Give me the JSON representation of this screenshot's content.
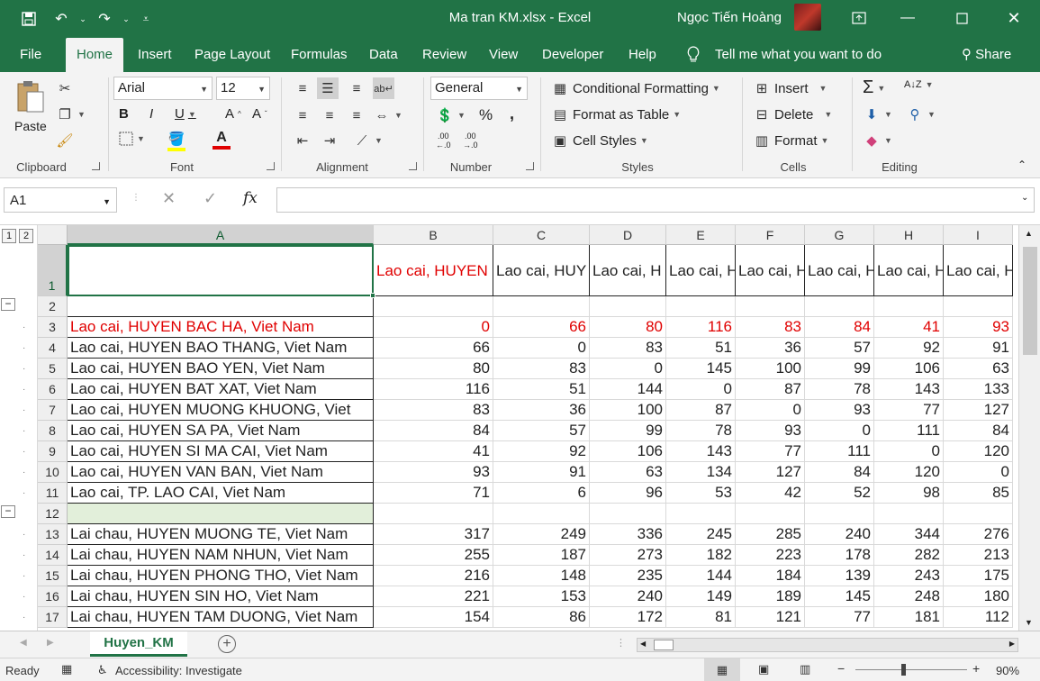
{
  "title_bar": {
    "file_title": "Ma tran KM.xlsx  -  Excel",
    "user_name": "Ngọc Tiến Hoàng"
  },
  "tabs": [
    "File",
    "Home",
    "Insert",
    "Page Layout",
    "Formulas",
    "Data",
    "Review",
    "View",
    "Developer",
    "Help"
  ],
  "active_tab": "Home",
  "tell_me": "Tell me what you want to do",
  "share": "Share",
  "ribbon": {
    "clipboard": {
      "paste": "Paste",
      "label": "Clipboard"
    },
    "font": {
      "name": "Arial",
      "size": "12",
      "label": "Font",
      "bold": "B",
      "italic": "I",
      "underline": "U",
      "font_color": "#e00000",
      "fill_color": "#ffff00"
    },
    "alignment": {
      "label": "Alignment"
    },
    "number": {
      "format": "General",
      "label": "Number",
      "percent": "%",
      "comma": ",",
      "inc_dec": ".00",
      "inc_dec2": "←.0",
      "dec_inc": ".00",
      "dec_inc2": "→.0"
    },
    "styles": {
      "conditional": "Conditional Formatting",
      "format_table": "Format as Table",
      "cell_styles": "Cell Styles",
      "label": "Styles"
    },
    "cells": {
      "insert": "Insert",
      "delete": "Delete",
      "format": "Format",
      "label": "Cells"
    },
    "editing": {
      "label": "Editing",
      "sigma": "Σ",
      "sort": "A↓Z"
    }
  },
  "formula_bar": {
    "name_box": "A1",
    "formula": "",
    "fx": "fx",
    "cancel": "✕",
    "enter": "✓"
  },
  "grid": {
    "columns": [
      "A",
      "B",
      "C",
      "D",
      "E",
      "F",
      "G",
      "H",
      "I"
    ],
    "header_row_values": [
      "",
      "Lao cai, HUYEN",
      "Lao cai, HUY",
      "Lao cai, H",
      "Lao cai, H",
      "Lao cai, H",
      "Lao cai, H",
      "Lao cai, H",
      "Lao cai, H"
    ],
    "rows": [
      {
        "num": "1",
        "label": "",
        "values": []
      },
      {
        "num": "2",
        "label": "",
        "values": []
      },
      {
        "num": "3",
        "label": "Lao cai, HUYEN BAC HA, Viet Nam",
        "values": [
          "0",
          "66",
          "80",
          "116",
          "83",
          "84",
          "41",
          "93"
        ],
        "red": true
      },
      {
        "num": "4",
        "label": "Lao cai, HUYEN BAO THANG, Viet Nam",
        "values": [
          "66",
          "0",
          "83",
          "51",
          "36",
          "57",
          "92",
          "91"
        ]
      },
      {
        "num": "5",
        "label": "Lao cai, HUYEN BAO YEN, Viet Nam",
        "values": [
          "80",
          "83",
          "0",
          "145",
          "100",
          "99",
          "106",
          "63"
        ]
      },
      {
        "num": "6",
        "label": "Lao cai, HUYEN BAT XAT, Viet Nam",
        "values": [
          "116",
          "51",
          "144",
          "0",
          "87",
          "78",
          "143",
          "133"
        ]
      },
      {
        "num": "7",
        "label": "Lao cai, HUYEN MUONG KHUONG, Viet",
        "values": [
          "83",
          "36",
          "100",
          "87",
          "0",
          "93",
          "77",
          "127"
        ]
      },
      {
        "num": "8",
        "label": "Lao cai, HUYEN SA PA, Viet Nam",
        "values": [
          "84",
          "57",
          "99",
          "78",
          "93",
          "0",
          "111",
          "84"
        ]
      },
      {
        "num": "9",
        "label": "Lao cai, HUYEN SI MA CAI, Viet Nam",
        "values": [
          "41",
          "92",
          "106",
          "143",
          "77",
          "111",
          "0",
          "120"
        ]
      },
      {
        "num": "10",
        "label": "Lao cai, HUYEN VAN BAN, Viet Nam",
        "values": [
          "93",
          "91",
          "63",
          "134",
          "127",
          "84",
          "120",
          "0"
        ]
      },
      {
        "num": "11",
        "label": "Lao cai, TP. LAO CAI, Viet Nam",
        "values": [
          "71",
          "6",
          "96",
          "53",
          "42",
          "52",
          "98",
          "85"
        ]
      },
      {
        "num": "12",
        "label": "",
        "values": [],
        "green": true
      },
      {
        "num": "13",
        "label": "Lai chau, HUYEN MUONG TE, Viet Nam",
        "values": [
          "317",
          "249",
          "336",
          "245",
          "285",
          "240",
          "344",
          "276"
        ]
      },
      {
        "num": "14",
        "label": "Lai chau, HUYEN NAM NHUN, Viet Nam",
        "values": [
          "255",
          "187",
          "273",
          "182",
          "223",
          "178",
          "282",
          "213"
        ]
      },
      {
        "num": "15",
        "label": "Lai chau, HUYEN PHONG THO, Viet Nam",
        "values": [
          "216",
          "148",
          "235",
          "144",
          "184",
          "139",
          "243",
          "175"
        ]
      },
      {
        "num": "16",
        "label": "Lai chau, HUYEN SIN HO, Viet Nam",
        "values": [
          "221",
          "153",
          "240",
          "149",
          "189",
          "145",
          "248",
          "180"
        ]
      },
      {
        "num": "17",
        "label": "Lai chau, HUYEN TAM DUONG, Viet Nam",
        "values": [
          "154",
          "86",
          "172",
          "81",
          "121",
          "77",
          "181",
          "112"
        ]
      }
    ]
  },
  "sheet_tab": "Huyen_KM",
  "status": {
    "ready": "Ready",
    "accessibility": "Accessibility: Investigate",
    "zoom": "90%"
  }
}
